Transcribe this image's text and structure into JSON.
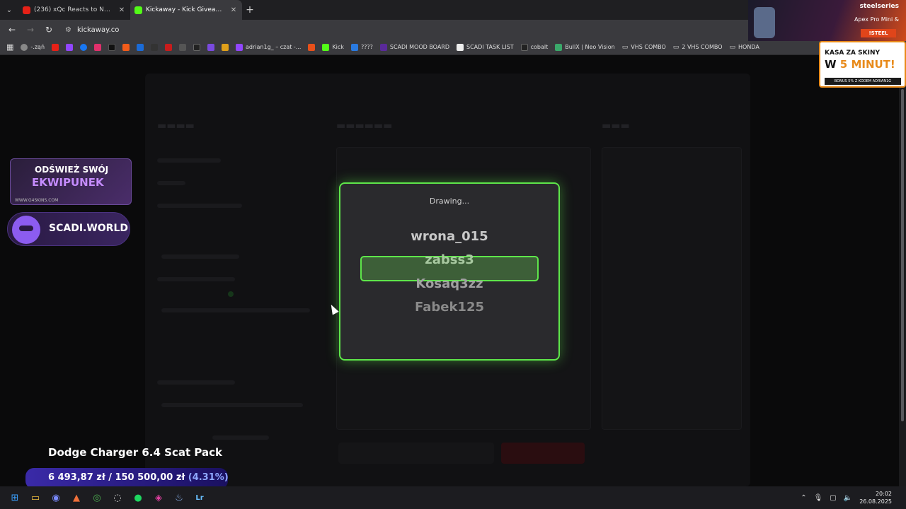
{
  "browser": {
    "tabs": [
      {
        "title": "(236) xQc Reacts to NEW Minecraft",
        "icon": "youtube-icon",
        "color": "#e62117",
        "active": false
      },
      {
        "title": "Kickaway - Kick Giveaway Tool",
        "icon": "kick-icon",
        "color": "#53fc18",
        "active": true
      }
    ],
    "url": "kickaway.co",
    "bookmarks": [
      {
        "label": "",
        "icon": "globe-icon",
        "color": "#888"
      },
      {
        "label": "",
        "icon": "youtube-icon",
        "color": "#e62117"
      },
      {
        "label": "",
        "icon": "twitch-icon",
        "color": "#9146ff"
      },
      {
        "label": "",
        "icon": "facebook-icon",
        "color": "#1877f2"
      },
      {
        "label": "",
        "icon": "instagram-icon",
        "color": "#e1306c"
      },
      {
        "label": "",
        "icon": "x-icon",
        "color": "#111"
      },
      {
        "label": "",
        "icon": "bookmark-icon",
        "color": "#f25c1a"
      },
      {
        "label": "",
        "icon": "paypal-icon",
        "color": "#1a6bd8"
      },
      {
        "label": "",
        "icon": "tip-icon",
        "color": "#333"
      },
      {
        "label": "",
        "icon": "bookmark-icon",
        "color": "#c81c1c"
      },
      {
        "label": "",
        "icon": "bookmark-icon",
        "color": "#555"
      },
      {
        "label": "",
        "icon": "tiktok-icon",
        "color": "#222"
      },
      {
        "label": "",
        "icon": "bookmark-icon",
        "color": "#7a4ae0"
      },
      {
        "label": "",
        "icon": "bookmark-icon",
        "color": "#e0a01a"
      },
      {
        "label": "adrian1g_ – czat -...",
        "icon": "twitch-icon",
        "color": "#9146ff"
      },
      {
        "label": "",
        "icon": "bookmark-icon",
        "color": "#e8501a"
      },
      {
        "label": "Kick",
        "icon": "kick-icon",
        "color": "#53fc18"
      },
      {
        "label": "????",
        "icon": "bookmark-icon",
        "color": "#2a7ae0"
      },
      {
        "label": "SCADI MOOD BOARD",
        "icon": "bookmark-icon",
        "color": "#5a2a9a"
      },
      {
        "label": "SCADI TASK LIST",
        "icon": "notion-icon",
        "color": "#eee"
      },
      {
        "label": "cobalt",
        "icon": "bookmark-icon",
        "color": "#222"
      },
      {
        "label": "BullX | Neo Vision",
        "icon": "bookmark-icon",
        "color": "#3aa86a"
      },
      {
        "label": "VHS COMBO",
        "icon": "folder-icon",
        "color": ""
      },
      {
        "label": "2 VHS COMBO",
        "icon": "folder-icon",
        "color": ""
      },
      {
        "label": "HONDA",
        "icon": "folder-icon",
        "color": ""
      }
    ]
  },
  "modal": {
    "title": "Drawing...",
    "names": [
      "wrona_015",
      "zabss3",
      "Kosaq3zz",
      "Fabek125"
    ]
  },
  "overlay": {
    "equip_line1": "ODŚWIEŻ SWÓJ",
    "equip_line2": "EKWIPUNEK",
    "equip_url": "WWW.G4SKINS.COM",
    "scadi": "SCADI.WORLD",
    "goal_title": "Dodge Charger 6.4 Scat Pack",
    "goal_current": "6 493,87 zł",
    "goal_sep": "/",
    "goal_target": "150 500,00 zł",
    "goal_pct": "(4.31%)",
    "steel_brand": "steelseries",
    "steel_product": "Apex Pro Mini &",
    "steel_code": "!STEEL",
    "skins_line1": "KASA ZA SKINY",
    "skins_w": "W",
    "skins_line2": "5 MINUT!",
    "skins_bonus": "BONUS 5% Z KODEM ADRIAN1G"
  },
  "taskbar": {
    "time": "20:02",
    "date": "26.08.2025"
  }
}
